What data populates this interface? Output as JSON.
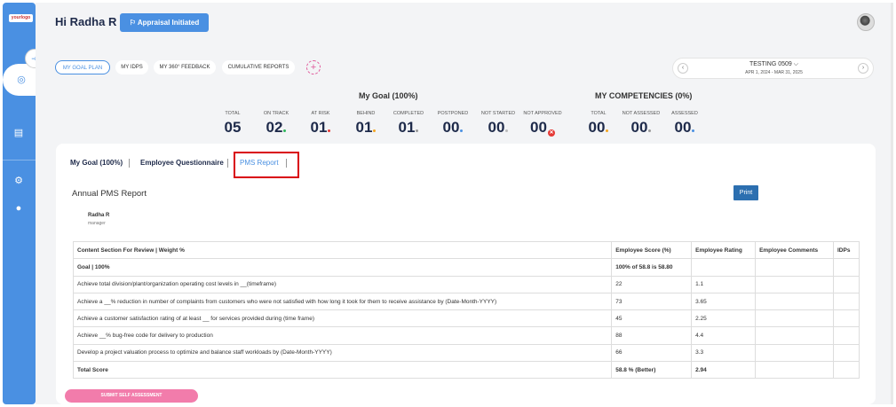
{
  "sidebar": {
    "logo_text": "yourlogo",
    "icons": [
      "collapse-menu-icon",
      "goal-target-icon",
      "report-icon",
      "settings-gear-icon",
      "user-icon"
    ]
  },
  "header": {
    "greeting": "Hi Radha R",
    "status_label": "Appraisal Initiated",
    "avatar_icon": "user-avatar"
  },
  "top_tabs": [
    {
      "label": "MY GOAL PLAN",
      "active": true
    },
    {
      "label": "MY IDPS",
      "active": false
    },
    {
      "label": "MY 360° FEEDBACK",
      "active": false
    },
    {
      "label": "CUMULATIVE REPORTS",
      "active": false
    }
  ],
  "add_tab_symbol": "+",
  "cycle": {
    "name": "TESTING 0509 ⌵",
    "dates": "APR 1, 2024 - MAR 31, 2025",
    "prev_symbol": "‹",
    "next_symbol": "›"
  },
  "goal_summary": {
    "title": "My Goal (100%)",
    "stats": [
      {
        "label": "TOTAL",
        "value": "05",
        "dot_color": ""
      },
      {
        "label": "ON TRACK",
        "value": "02",
        "dot_color": "#2eb85c"
      },
      {
        "label": "AT RISK",
        "value": "01",
        "dot_color": "#e53935"
      },
      {
        "label": "BEHIND",
        "value": "01",
        "dot_color": "#f5a623"
      },
      {
        "label": "COMPLETED",
        "value": "01",
        "dot_color": "#999999"
      },
      {
        "label": "POSTPONED",
        "value": "00",
        "dot_color": "#4a90e2"
      },
      {
        "label": "NOT STARTED",
        "value": "00",
        "dot_color": "#bbbbbb"
      },
      {
        "label": "NOT APPROVED",
        "value": "00",
        "dot_color": "#e53935"
      }
    ]
  },
  "competency_summary": {
    "title": "MY COMPETENCIES (0%)",
    "stats": [
      {
        "label": "TOTAL",
        "value": "00",
        "dot_color": "#f5a623"
      },
      {
        "label": "NOT ASSESSED",
        "value": "00",
        "dot_color": "#999999"
      },
      {
        "label": "ASSESSED",
        "value": "00",
        "dot_color": "#4a90e2"
      }
    ]
  },
  "sub_tabs": [
    {
      "label": "My Goal (100%)",
      "active": false
    },
    {
      "label": "Employee Questionnaire",
      "active": false
    },
    {
      "label": "PMS Report",
      "active": true
    }
  ],
  "report": {
    "title": "Annual PMS Report",
    "print_label": "Print",
    "employee_name": "Radha R",
    "employee_role": "manager",
    "columns": [
      "Content Section For Review | Weight %",
      "Employee Score (%)",
      "Employee Rating",
      "Employee Comments",
      "IDPs"
    ],
    "rows": [
      {
        "cells": [
          "Goal | 100%",
          "100% of 58.8 is 58.80",
          "",
          "",
          ""
        ],
        "bold": true
      },
      {
        "cells": [
          "Achieve total division/plant/organization operating cost levels in __(timeframe)",
          "22",
          "1.1",
          "",
          ""
        ],
        "bold": false
      },
      {
        "cells": [
          "Achieve a __% reduction in number of complaints from customers who were not satisfied with how long it took for them to receive assistance by (Date-Month-YYYY)",
          "73",
          "3.65",
          "",
          ""
        ],
        "bold": false
      },
      {
        "cells": [
          "Achieve a customer satisfaction rating of at least __ for services provided during (time frame)",
          "45",
          "2.25",
          "",
          ""
        ],
        "bold": false
      },
      {
        "cells": [
          "Achieve __% bug-free code for delivery to production",
          "88",
          "4.4",
          "",
          ""
        ],
        "bold": false
      },
      {
        "cells": [
          "Develop a project valuation process to optimize and balance staff workloads by (Date-Month-YYYY)",
          "66",
          "3.3",
          "",
          ""
        ],
        "bold": false
      },
      {
        "cells": [
          "Total Score",
          "58.8 % (Better)",
          "2.94",
          "",
          ""
        ],
        "bold": true
      }
    ]
  },
  "submit_label": "SUBMIT SELF ASSESSMENT"
}
